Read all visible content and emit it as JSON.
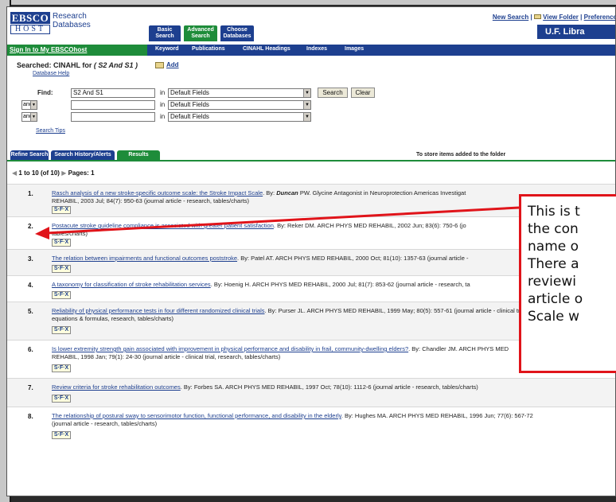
{
  "header": {
    "logo_top": "EBSCO",
    "logo_bottom": "HOST",
    "logo_text_1": "Research",
    "logo_text_2": "Databases",
    "tabs": [
      {
        "line1": "Basic",
        "line2": "Search"
      },
      {
        "line1": "Advanced",
        "line2": "Search"
      },
      {
        "line1": "Choose",
        "line2": "Databases"
      }
    ],
    "links": {
      "new_search": "New Search",
      "sep1": "|",
      "view_folder": "View Folder",
      "sep2": "|",
      "preferences": "Preference"
    },
    "library": "U.F. Libra"
  },
  "nav": {
    "signin": "Sign In to My EBSCOhost",
    "items": [
      "Keyword",
      "Publications",
      "CINAHL Headings",
      "Indexes",
      "Images"
    ]
  },
  "search": {
    "searched_label": "Searched: CINAHL for",
    "searched_query": "( S2 And S1 )",
    "add": "Add",
    "db_help": "Database Help",
    "find_label": "Find:",
    "rows": [
      {
        "value": "S2 And S1",
        "in": "in",
        "field": "Default Fields"
      },
      {
        "op": "and",
        "value": "",
        "in": "in",
        "field": "Default Fields"
      },
      {
        "op": "and",
        "value": "",
        "in": "in",
        "field": "Default Fields"
      }
    ],
    "search_btn": "Search",
    "clear_btn": "Clear",
    "search_tips": "Search Tips"
  },
  "result_tabs": [
    "Refine Search",
    "Search History/Alerts",
    "Results"
  ],
  "to_store": "To store items added to the folder",
  "pager": {
    "range": "1 to 10",
    "of": "(of 10)",
    "pages_label": "Pages:",
    "page": "1"
  },
  "results": [
    {
      "n": "1.",
      "title": "Rasch analysis of a new stroke-specific outcome scale: the Stroke Impact Scale",
      "by": "By:",
      "author": "Duncan",
      "rest": "PW. Glycine Antagonist in Neuroprotection Americas Investigat",
      "line2": "REHABIL, 2003 Jul; 84(7): 950-63 (journal article - research, tables/charts)"
    },
    {
      "n": "2.",
      "title": "Postacute stroke guideline compliance is associated with greater patient satisfaction",
      "by": "By:",
      "author": "",
      "rest": "Reker DM. ARCH PHYS MED REHABIL, 2002 Jun; 83(6): 750-6 (jo",
      "line2": "tables/charts)"
    },
    {
      "n": "3.",
      "title": "The relation between impairments and functional outcomes poststroke",
      "by": "By:",
      "author": "",
      "rest": "Patel AT. ARCH PHYS MED REHABIL, 2000 Oct; 81(10): 1357-63 (journal article -",
      "line2": ""
    },
    {
      "n": "4.",
      "title": "A taxonomy for classification of stroke rehabilitation services",
      "by": "By:",
      "author": "",
      "rest": "Hoenig H. ARCH PHYS MED REHABIL, 2000 Jul; 81(7): 853-62 (journal article - research, ta",
      "line2": ""
    },
    {
      "n": "5.",
      "title": "Reliability of physical performance tests in four different randomized clinical trials",
      "by": "By:",
      "author": "",
      "rest": "Purser JL. ARCH PHYS MED REHABIL, 1999 May; 80(5): 557-61 (journal article - clinical trial,",
      "line2": "equations & formulas, research, tables/charts)"
    },
    {
      "n": "6.",
      "title": "Is lower extremity strength gain associated with improvement in physical performance and disability in frail, community-dwelling elders?",
      "by": "By:",
      "author": "",
      "rest": "Chandler JM. ARCH PHYS MED",
      "line2": "REHABIL, 1998 Jan; 79(1): 24-30 (journal article - clinical trial, research, tables/charts)"
    },
    {
      "n": "7.",
      "title": "Review criteria for stroke rehabilitation outcomes",
      "by": "By:",
      "author": "",
      "rest": "Forbes SA. ARCH PHYS MED REHABIL, 1997 Oct; 78(10): 1112-6 (journal article - research, tables/charts)",
      "line2": ""
    },
    {
      "n": "8.",
      "title": "The relationship of postural sway to sensorimotor function, functional performance, and disability in the elderly",
      "by": "By:",
      "author": "",
      "rest": "Hughes MA. ARCH PHYS MED REHABIL, 1996 Jun; 77(6): 567-72",
      "line2": "(journal article - research, tables/charts)"
    }
  ],
  "sfx_label": "S·F·X",
  "callout": {
    "lines": [
      "This is t",
      "the con",
      "name o",
      "There a",
      "reviewi",
      "article o",
      "Scale w"
    ]
  },
  "colors": {
    "accent_blue": "#1d3f8f",
    "accent_green": "#1e8c3a",
    "callout_red": "#e0141a"
  }
}
